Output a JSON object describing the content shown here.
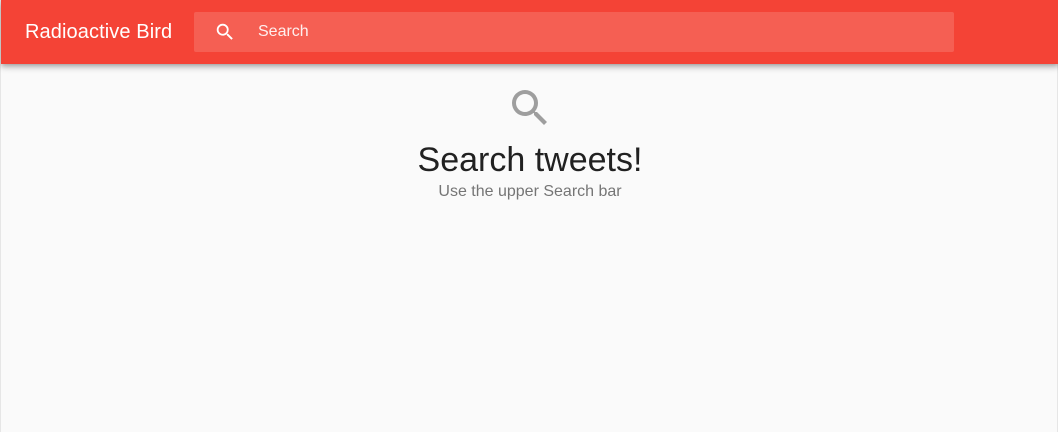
{
  "appbar": {
    "title": "Radioactive Bird",
    "color": "#f44336"
  },
  "search": {
    "placeholder": "Search",
    "value": "",
    "icon": "search-icon"
  },
  "empty_state": {
    "icon": "search-icon",
    "title": "Search tweets!",
    "subtitle": "Use the upper Search bar"
  }
}
